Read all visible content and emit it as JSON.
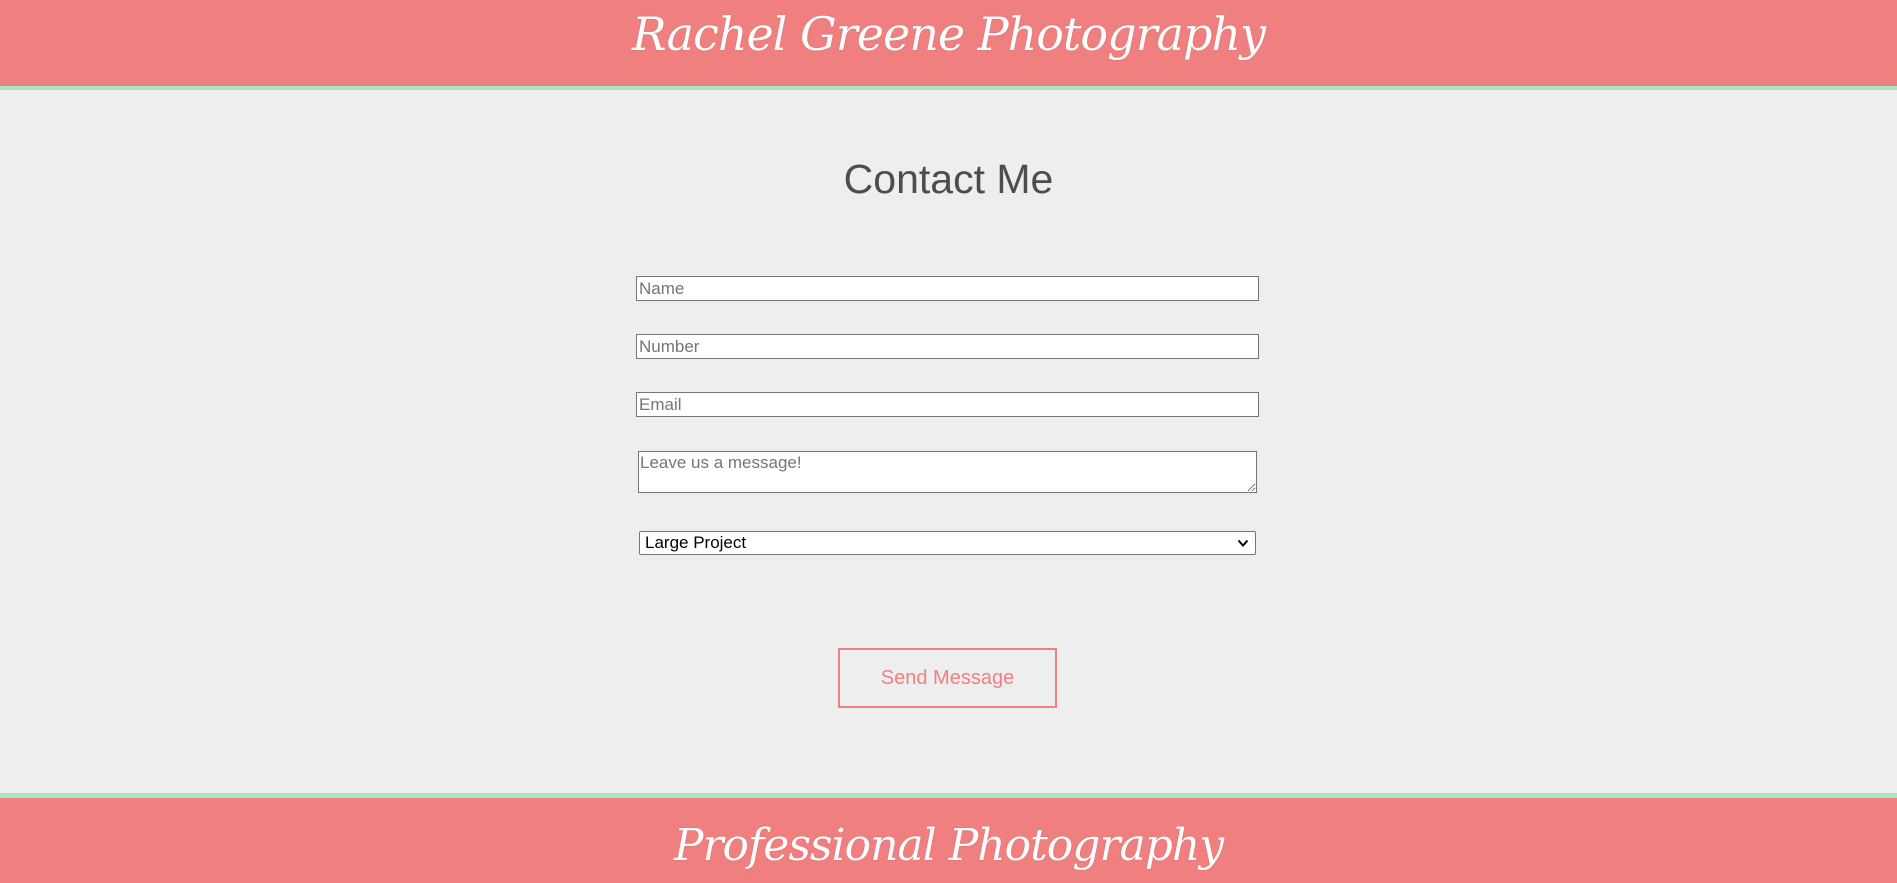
{
  "header": {
    "brand": "Rachel Greene Photography"
  },
  "main": {
    "title": "Contact Me",
    "form": {
      "name_placeholder": "Name",
      "number_placeholder": "Number",
      "email_placeholder": "Email",
      "message_placeholder": "Leave us a message!",
      "project_select": {
        "selected": "Large Project"
      },
      "send_label": "Send Message"
    }
  },
  "footer": {
    "tagline": "Professional Photography"
  },
  "colors": {
    "brand_coral": "#f08080",
    "accent_mint": "#a8e6c3",
    "page_background": "#eeeeee",
    "title_text": "#4d4d4d"
  },
  "icons": {
    "select_arrow": "chevron-down-icon"
  }
}
